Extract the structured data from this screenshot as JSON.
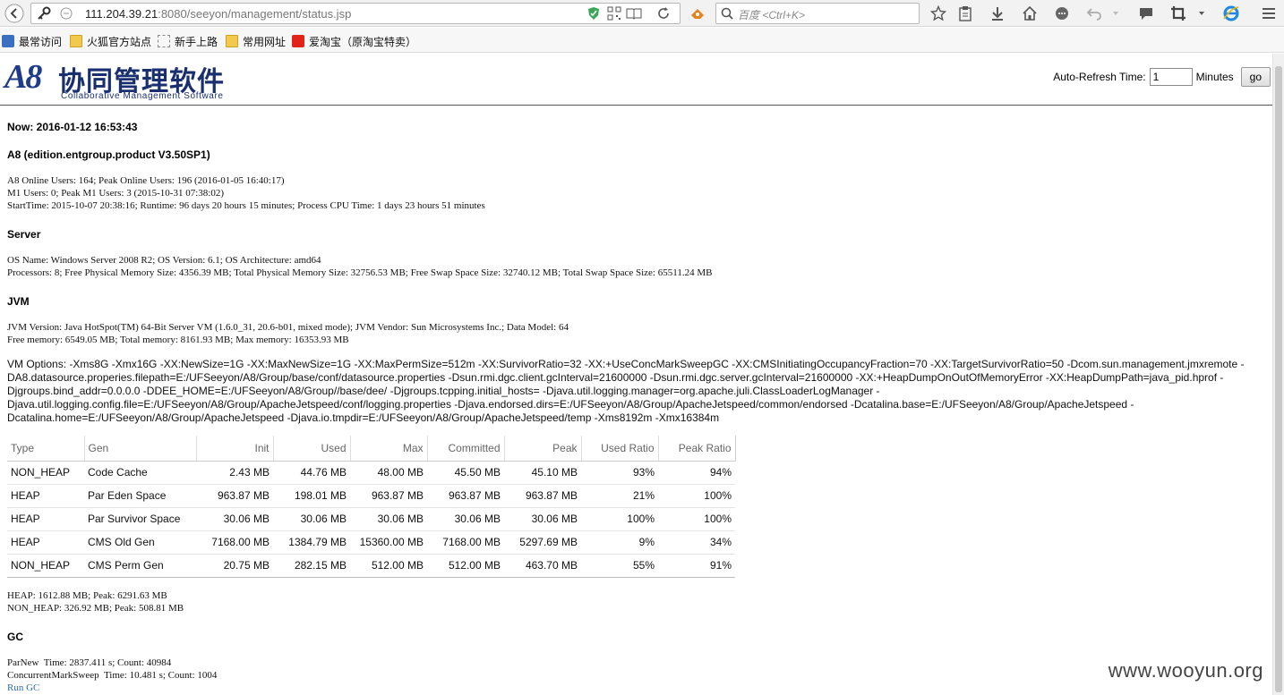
{
  "browser": {
    "url_host": "111.204.39.21",
    "url_rest": ":8080/seeyon/management/status.jsp",
    "search_placeholder": "百度 <Ctrl+K>"
  },
  "bookmarks": [
    {
      "label": "最常访问",
      "icon": "bookmark-icon"
    },
    {
      "label": "火狐官方站点",
      "icon": "folder-icon"
    },
    {
      "label": "新手上路",
      "icon": "page-icon"
    },
    {
      "label": "常用网址",
      "icon": "folder-icon"
    },
    {
      "label": "爱淘宝（原淘宝特卖）",
      "icon": "taobao-icon"
    }
  ],
  "logo": {
    "mark": "A8",
    "name_cn": "协同管理软件",
    "name_en": "Collaborative Management Software"
  },
  "refresh": {
    "label": "Auto-Refresh Time:",
    "value": "1",
    "unit": "Minutes",
    "button": "go"
  },
  "status": {
    "now": "Now: 2016-01-12 16:53:43",
    "edition": "A8 (edition.entgroup.product V3.50SP1)",
    "users": [
      "A8 Online Users: 164; Peak Online Users: 196 (2016-01-05 16:40:17)",
      "M1 Users: 0; Peak M1 Users: 3 (2015-10-31 07:38:02)",
      "StartTime: 2015-10-07 20:38:16; Runtime: 96 days 20 hours 15 minutes; Process CPU Time: 1 days 23 hours 51 minutes"
    ],
    "server_title": "Server",
    "server": [
      "OS Name: Windows Server 2008 R2; OS Version: 6.1; OS Architecture: amd64",
      "Processors: 8; Free Physical Memory Size: 4356.39 MB; Total Physical Memory Size: 32756.53 MB; Free Swap Space Size: 32740.12 MB; Total Swap Space Size: 65511.24 MB"
    ],
    "jvm_title": "JVM",
    "jvm": [
      "JVM Version: Java HotSpot(TM) 64-Bit Server VM (1.6.0_31, 20.6-b01, mixed mode); JVM Vendor: Sun Microsystems Inc.; Data Model: 64",
      "Free memory: 6549.05 MB; Total memory: 8161.93 MB; Max memory: 16353.93 MB"
    ],
    "vm_options": "VM Options: -Xms8G -Xmx16G -XX:NewSize=1G -XX:MaxNewSize=1G -XX:MaxPermSize=512m -XX:SurvivorRatio=32 -XX:+UseConcMarkSweepGC -XX:CMSInitiatingOccupancyFraction=70 -XX:TargetSurvivorRatio=50 -Dcom.sun.management.jmxremote -DA8.datasource.properies.filepath=E:/UFSeeyon/A8/Group/base/conf/datasource.properties -Dsun.rmi.dgc.client.gcInterval=21600000 -Dsun.rmi.dgc.server.gcInterval=21600000 -XX:+HeapDumpOnOutOfMemoryError -XX:HeapDumpPath=java_pid.hprof -Djgroups.bind_addr=0.0.0.0 -DDEE_HOME=E:/UFSeeyon/A8/Group//base/dee/ -Djgroups.tcpping.initial_hosts= -Djava.util.logging.manager=org.apache.juli.ClassLoaderLogManager -Djava.util.logging.config.file=E:/UFSeeyon/A8/Group/ApacheJetspeed/conf/logging.properties -Djava.endorsed.dirs=E:/UFSeeyon/A8/Group/ApacheJetspeed/common/endorsed -Dcatalina.base=E:/UFSeeyon/A8/Group/ApacheJetspeed -Dcatalina.home=E:/UFSeeyon/A8/Group/ApacheJetspeed -Djava.io.tmpdir=E:/UFSeeyon/A8/Group/ApacheJetspeed/temp -Xms8192m -Xmx16384m",
    "memory_summary": [
      "HEAP: 1612.88 MB; Peak: 6291.63 MB",
      "NON_HEAP: 326.92 MB; Peak: 508.81 MB"
    ],
    "gc_title": "GC",
    "gc": [
      "ParNew  Time: 2837.411 s; Count: 40984",
      "ConcurrentMarkSweep  Time: 10.481 s; Count: 1004"
    ],
    "run_gc": "Run GC"
  },
  "memory_table": {
    "headers": [
      "Type",
      "Gen",
      "Init",
      "Used",
      "Max",
      "Committed",
      "Peak",
      "Used Ratio",
      "Peak Ratio"
    ],
    "rows": [
      [
        "NON_HEAP",
        "Code Cache",
        "2.43 MB",
        "44.76 MB",
        "48.00 MB",
        "45.50 MB",
        "45.10 MB",
        "93%",
        "94%"
      ],
      [
        "HEAP",
        "Par Eden Space",
        "963.87 MB",
        "198.01 MB",
        "963.87 MB",
        "963.87 MB",
        "963.87 MB",
        "21%",
        "100%"
      ],
      [
        "HEAP",
        "Par Survivor Space",
        "30.06 MB",
        "30.06 MB",
        "30.06 MB",
        "30.06 MB",
        "30.06 MB",
        "100%",
        "100%"
      ],
      [
        "HEAP",
        "CMS Old Gen",
        "7168.00 MB",
        "1384.79 MB",
        "15360.00 MB",
        "7168.00 MB",
        "5297.69 MB",
        "9%",
        "34%"
      ],
      [
        "NON_HEAP",
        "CMS Perm Gen",
        "20.75 MB",
        "282.15 MB",
        "512.00 MB",
        "512.00 MB",
        "463.70 MB",
        "55%",
        "91%"
      ]
    ]
  },
  "watermark": "www.wooyun.org"
}
